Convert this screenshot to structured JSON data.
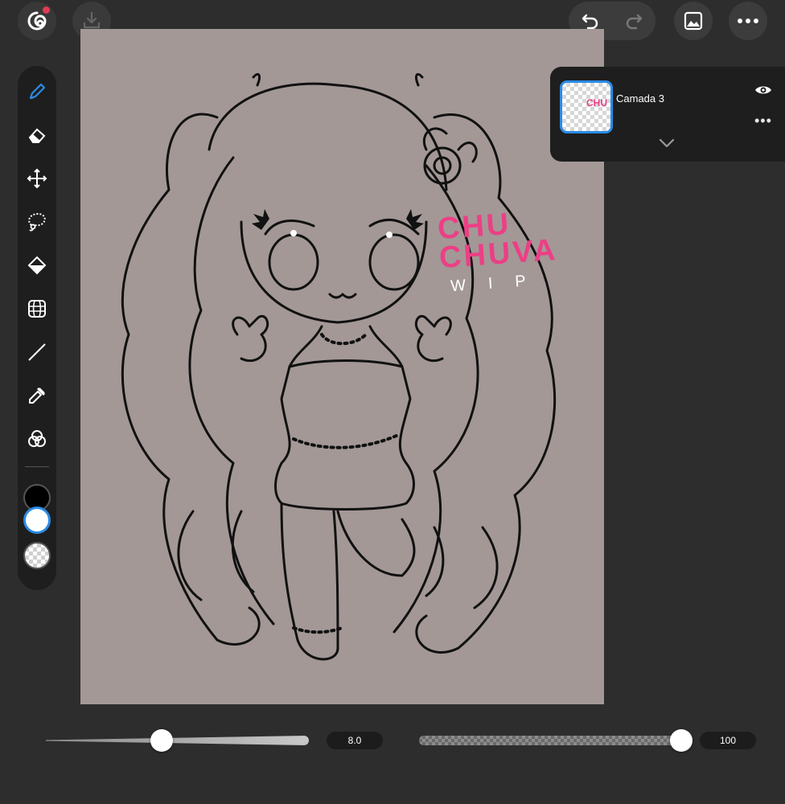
{
  "header": {
    "logo_icon": "spiral-logo-icon",
    "notification_color": "#e23b55",
    "save_icon": "download-tray-icon",
    "undo_icon": "undo-arrow-icon",
    "redo_icon": "redo-arrow-icon",
    "gallery_icon": "image-gallery-icon",
    "more_icon": "more-dots-icon"
  },
  "canvas": {
    "background": "#a39896",
    "watermark_line1": "CHU",
    "watermark_line2": "CHUVA",
    "watermark_line3": "WIP",
    "watermark_color": "#ec3f86"
  },
  "toolbar": {
    "tools": [
      {
        "name": "brush",
        "icon": "pen-icon",
        "active": true
      },
      {
        "name": "eraser",
        "icon": "eraser-icon",
        "active": false
      },
      {
        "name": "transform",
        "icon": "move-arrows-icon",
        "active": false
      },
      {
        "name": "lasso",
        "icon": "lasso-icon",
        "active": false
      },
      {
        "name": "fill",
        "icon": "paint-bucket-icon",
        "active": false
      },
      {
        "name": "perspective",
        "icon": "perspective-grid-icon",
        "active": false
      },
      {
        "name": "line",
        "icon": "line-icon",
        "active": false
      },
      {
        "name": "eyedropper",
        "icon": "eyedropper-icon",
        "active": false
      },
      {
        "name": "blend",
        "icon": "color-circles-icon",
        "active": false
      }
    ],
    "primary_color": "#000000",
    "secondary_color": "#ffffff",
    "accent": "#2b8be6"
  },
  "layers": {
    "current_layer_name": "Camada 3",
    "thumbnail_mark": "CHU",
    "visible": true
  },
  "brush_size": {
    "value_label": "8.0",
    "fraction": 0.44
  },
  "brush_opacity": {
    "value_label": "100",
    "fraction": 1.0
  }
}
